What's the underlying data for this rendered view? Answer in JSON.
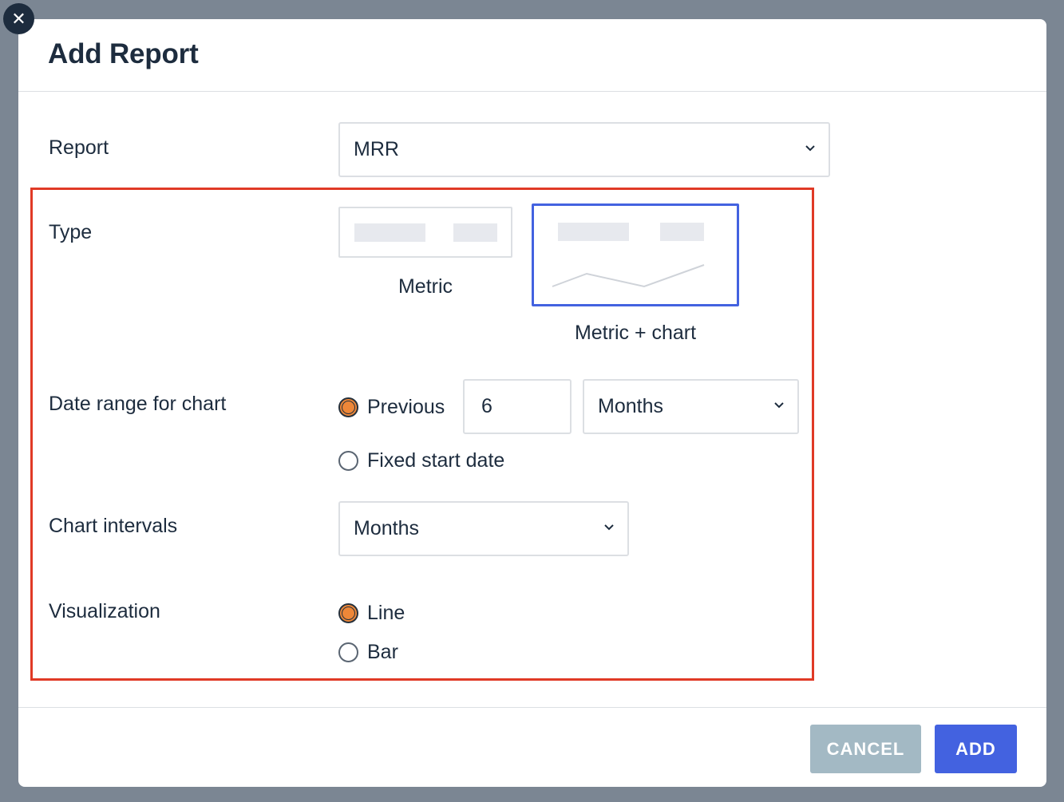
{
  "dialog": {
    "title": "Add Report",
    "close_icon": "close-icon"
  },
  "report": {
    "label": "Report",
    "value": "MRR"
  },
  "type": {
    "label": "Type",
    "options": [
      {
        "label": "Metric",
        "selected": false
      },
      {
        "label": "Metric + chart",
        "selected": true
      }
    ]
  },
  "date_range": {
    "label": "Date range for chart",
    "previous_label": "Previous",
    "previous_checked": true,
    "count_value": "6",
    "unit_value": "Months",
    "fixed_label": "Fixed start date",
    "fixed_checked": false
  },
  "chart_intervals": {
    "label": "Chart intervals",
    "value": "Months"
  },
  "visualization": {
    "label": "Visualization",
    "options": [
      {
        "label": "Line",
        "checked": true
      },
      {
        "label": "Bar",
        "checked": false
      }
    ]
  },
  "footer": {
    "cancel_label": "CANCEL",
    "add_label": "ADD"
  },
  "colors": {
    "accent": "#4362e0",
    "radio_checked": "#ee8738",
    "highlight": "#e03a26",
    "cancel_disabled": "#a3b9c4"
  }
}
